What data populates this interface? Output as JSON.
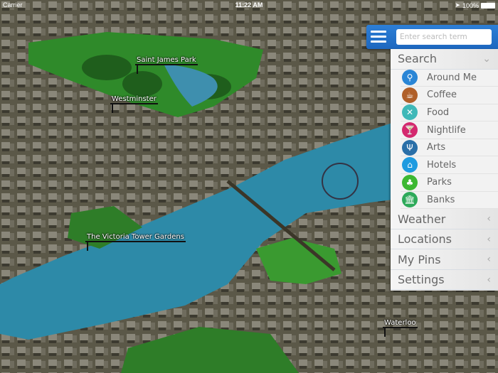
{
  "status_bar": {
    "carrier": "Carrier",
    "time": "11:22 AM",
    "battery": "100%"
  },
  "map_labels": {
    "park": "Saint James Park",
    "westminster": "Westminster",
    "gardens": "The Victoria Tower Gardens",
    "waterloo": "Waterloo"
  },
  "search": {
    "placeholder": "Enter search term",
    "value": ""
  },
  "menu": {
    "search": {
      "label": "Search",
      "expanded": true
    },
    "items": [
      {
        "label": "Around Me",
        "icon": "person-location-icon",
        "color": "#2a86d6",
        "glyph": "⚲"
      },
      {
        "label": "Coffee",
        "icon": "coffee-cup-icon",
        "color": "#b0602a",
        "glyph": "☕"
      },
      {
        "label": "Food",
        "icon": "fork-knife-icon",
        "color": "#3fb8b8",
        "glyph": "✕"
      },
      {
        "label": "Nightlife",
        "icon": "cocktail-icon",
        "color": "#d4286e",
        "glyph": "🍸"
      },
      {
        "label": "Arts",
        "icon": "lyre-icon",
        "color": "#2a6fa8",
        "glyph": "Ψ"
      },
      {
        "label": "Hotels",
        "icon": "bed-icon",
        "color": "#1f9be0",
        "glyph": "⌂"
      },
      {
        "label": "Parks",
        "icon": "trees-icon",
        "color": "#3cb832",
        "glyph": "♣"
      },
      {
        "label": "Banks",
        "icon": "bank-icon",
        "color": "#2eaa5a",
        "glyph": "🏛"
      }
    ],
    "sections": [
      {
        "label": "Weather"
      },
      {
        "label": "Locations"
      },
      {
        "label": "My Pins"
      },
      {
        "label": "Settings"
      }
    ]
  }
}
